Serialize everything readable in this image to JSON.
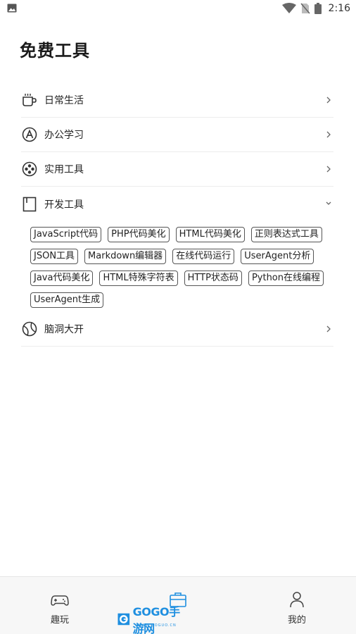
{
  "status_bar": {
    "time": "2:16",
    "icons": [
      "image-icon",
      "wifi-icon",
      "no-sim-icon",
      "battery-icon"
    ]
  },
  "page": {
    "title": "免费工具"
  },
  "sections": [
    {
      "label": "日常生活",
      "icon": "coffee-cup-icon",
      "expanded": false
    },
    {
      "label": "办公学习",
      "icon": "circle-a-icon",
      "expanded": false
    },
    {
      "label": "实用工具",
      "icon": "film-reel-icon",
      "expanded": false
    },
    {
      "label": "开发工具",
      "icon": "book-icon",
      "expanded": true,
      "tags": [
        "JavaScript代码",
        "PHP代码美化",
        "HTML代码美化",
        "正则表达式工具",
        "JSON工具",
        "Markdown编辑器",
        "在线代码运行",
        "UserAgent分析",
        "Java代码美化",
        "HTML特殊字符表",
        "HTTP状态码",
        "Python在线编程",
        "UserAgent生成"
      ]
    },
    {
      "label": "脑洞大开",
      "icon": "ball-icon",
      "expanded": false
    }
  ],
  "bottom_nav": {
    "items": [
      {
        "label": "趣玩",
        "icon": "gamepad-icon"
      },
      {
        "label": "",
        "icon": "briefcase-icon",
        "active": true
      },
      {
        "label": "我的",
        "icon": "user-icon"
      }
    ]
  },
  "watermark": {
    "logo_text": "GOGO手游网",
    "sub_text": "WWW.GOGUO.CN"
  },
  "colors": {
    "accent": "#1f8fe0",
    "text": "#222222",
    "divider": "#ececec",
    "nav_bg": "#f7f7f7"
  }
}
